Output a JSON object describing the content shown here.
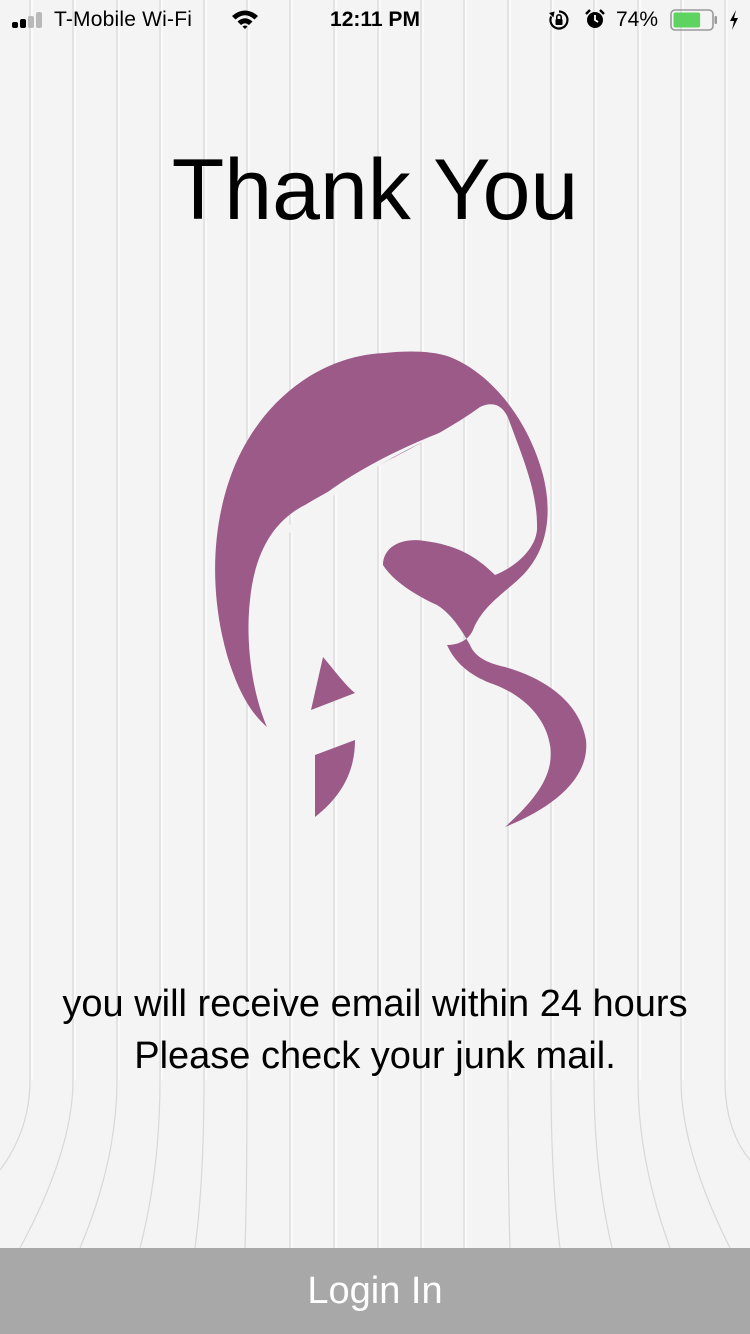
{
  "status_bar": {
    "carrier": "T-Mobile Wi-Fi",
    "time": "12:11 PM",
    "battery_percent": "74%",
    "battery_level": 0.74,
    "signal_bars_filled": 2,
    "signal_bars_total": 4,
    "icons": [
      "wifi-icon",
      "rotation-lock-icon",
      "alarm-icon",
      "battery-icon",
      "charging-icon"
    ]
  },
  "content": {
    "title": "Thank You",
    "logo": "woman-silhouette-logo",
    "message_line1": "you will receive email within 24 hours",
    "message_line2": "Please check your junk mail."
  },
  "footer": {
    "login_label": "Login In"
  },
  "colors": {
    "background": "#f4f4f4",
    "logo": "#9b5a87",
    "button_background": "#a8a8a8",
    "button_text": "#ffffff",
    "battery_fill": "#5fd35f"
  }
}
